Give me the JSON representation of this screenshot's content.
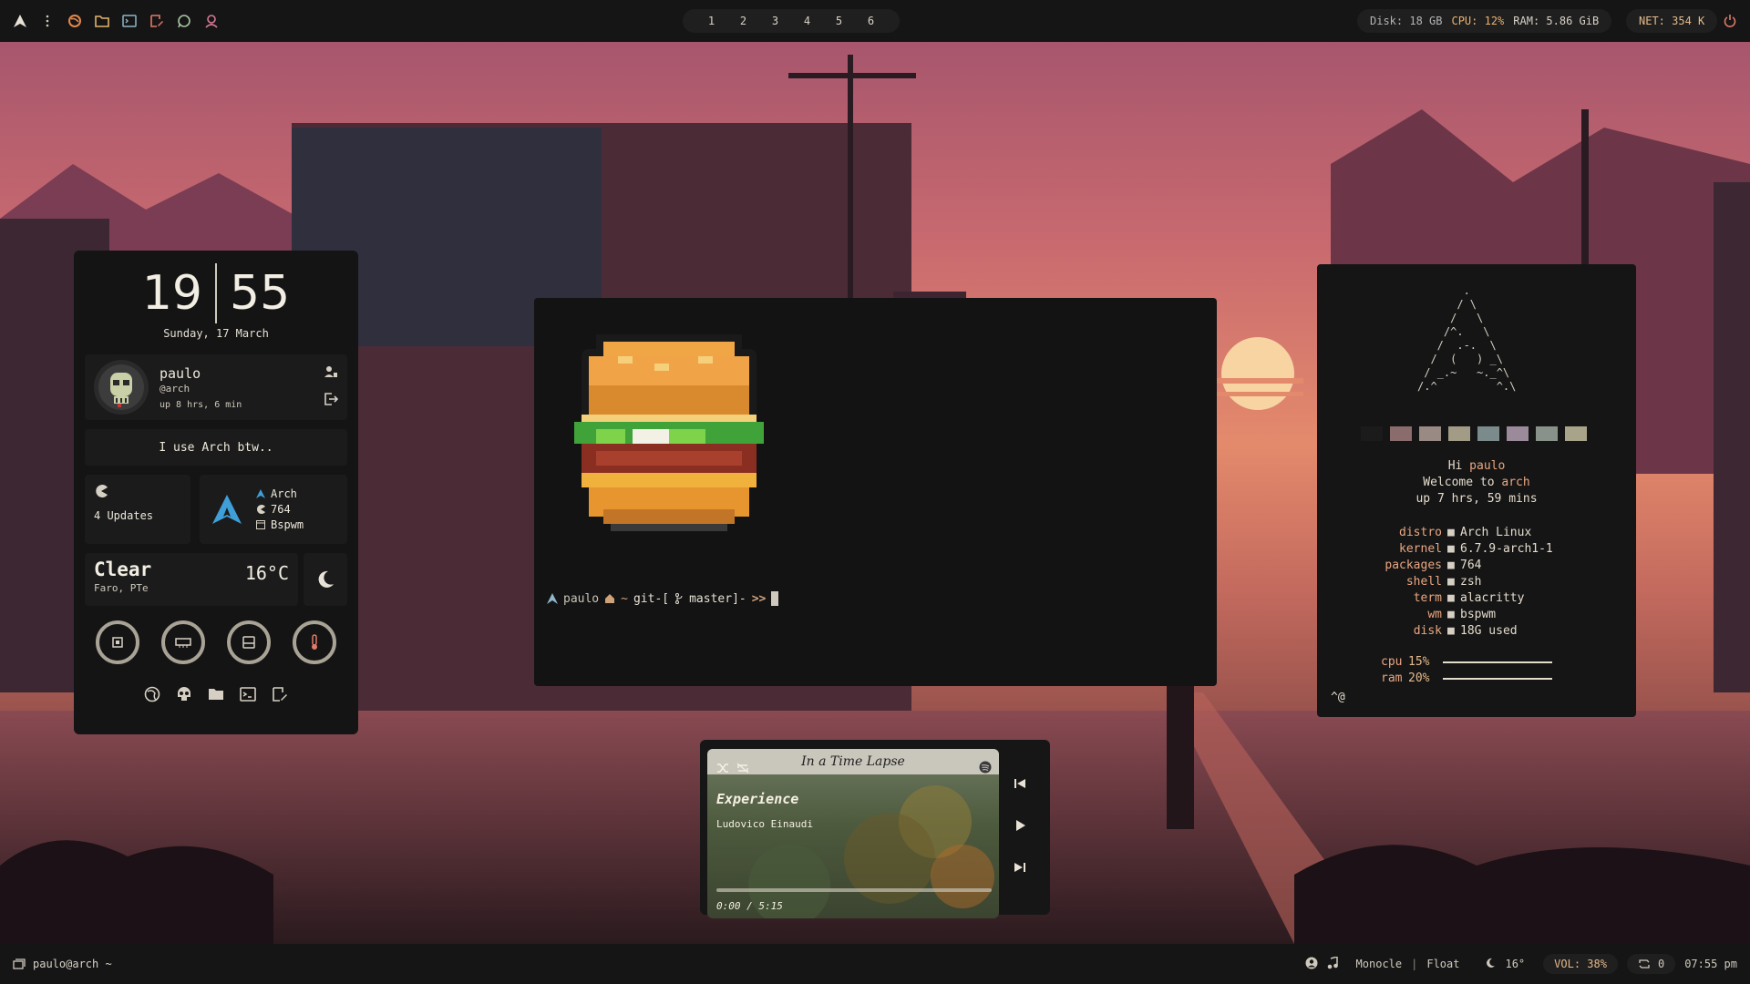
{
  "topbar": {
    "workspaces": [
      "1",
      "2",
      "3",
      "4",
      "5",
      "6"
    ],
    "disk": "Disk: 18 GB",
    "cpu": "CPU: 12%",
    "ram": "RAM: 5.86 GiB",
    "net": "NET: 354 K"
  },
  "dashboard": {
    "hour": "19",
    "minute": "55",
    "date": "Sunday, 17 March",
    "user": {
      "name": "paulo",
      "host": "@arch",
      "uptime": "up 8 hrs, 6 min"
    },
    "quote": "I use Arch btw..",
    "updates": "4 Updates",
    "distro": {
      "name": "Arch",
      "packages": "764",
      "wm": "Bspwm"
    },
    "weather": {
      "condition": "Clear",
      "location": "Faro, PTe",
      "temp": "16°C"
    }
  },
  "terminal": {
    "user": "paulo",
    "path": "~",
    "git": "git-[",
    "branch": "master]-",
    "arrows": ">>"
  },
  "fetch": {
    "greeting_hi": "Hi",
    "greeting_user": "paulo",
    "welcome_to": "Welcome to",
    "welcome_host": "arch",
    "uptime": "up 7 hrs, 59 mins",
    "rows": [
      {
        "k": "distro",
        "v": "Arch Linux"
      },
      {
        "k": "kernel",
        "v": "6.7.9-arch1-1"
      },
      {
        "k": "packages",
        "v": "764"
      },
      {
        "k": "shell",
        "v": "zsh"
      },
      {
        "k": "term",
        "v": "alacritty"
      },
      {
        "k": "wm",
        "v": "bspwm"
      },
      {
        "k": "disk",
        "v": "18G used"
      }
    ],
    "cpu_label": "cpu",
    "cpu_value": "15%",
    "ram_label": "ram",
    "ram_value": "20%",
    "caret": "^@",
    "swatch_colors": [
      "#1b1b1b",
      "#8a6c6c",
      "#9a8a84",
      "#a29c86",
      "#7b8a8a",
      "#9a8a9a",
      "#88928a",
      "#a8a48a"
    ]
  },
  "player": {
    "album": "In a Time Lapse",
    "song": "Experience",
    "artist": "Ludovico Einaudi",
    "time": "0:00 / 5:15",
    "progress": 0.0
  },
  "bottombar": {
    "session": "paulo@arch ~",
    "layout_monocle": "Monocle",
    "layout_sep": "|",
    "layout_float": "Float",
    "temp": "16°",
    "volume": "VOL: 38%",
    "updates": "0",
    "time": "07:55 pm"
  },
  "colors": {
    "accent": "#e9a681",
    "arch_blue": "#3f9fd9",
    "panel": "#141414"
  }
}
